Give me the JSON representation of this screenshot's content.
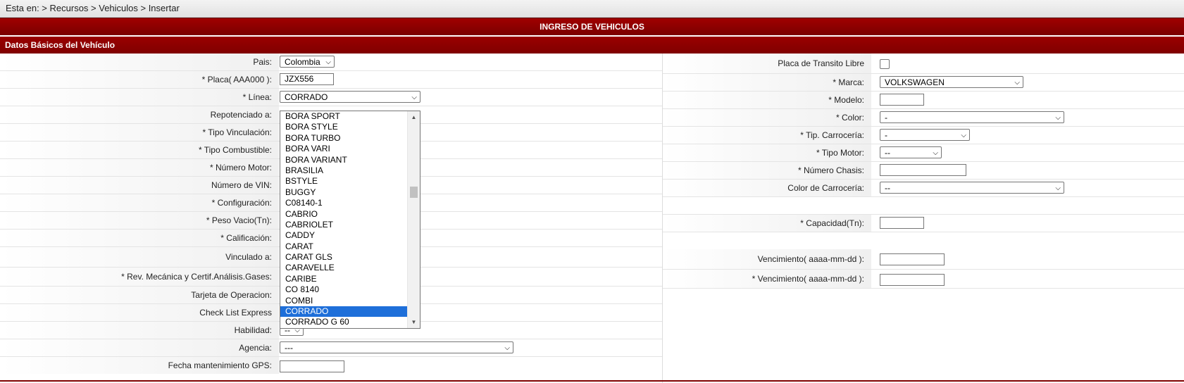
{
  "breadcrumb": "Esta en: > Recursos > Vehiculos > Insertar",
  "page_title": "INGRESO DE VEHICULOS",
  "section_title": "Datos Básicos del Vehículo",
  "left_rows": [
    {
      "label": "Pais:",
      "value": "Colombia"
    },
    {
      "label": "* Placa( AAA000 ):",
      "value": "JZX556"
    },
    {
      "label": "* Línea:",
      "value": "CORRADO"
    },
    {
      "label": "Repotenciado a:"
    },
    {
      "label": "* Tipo Vinculación:"
    },
    {
      "label": "* Tipo Combustible:"
    },
    {
      "label": "* Número Motor:"
    },
    {
      "label": "Número de VIN:"
    },
    {
      "label": "* Configuración:"
    },
    {
      "label": "* Peso Vacio(Tn):"
    },
    {
      "label": "* Calificación:"
    },
    {
      "label": "Vinculado a:"
    },
    {
      "label": "* Rev. Mecánica y Certif.Análisis.Gases:"
    },
    {
      "label": "Tarjeta de Operacion:"
    },
    {
      "label": "Check List Express"
    },
    {
      "label": "Habilidad:",
      "value": "--"
    },
    {
      "label": "Agencia:",
      "value": "---"
    },
    {
      "label": "Fecha mantenimiento GPS:",
      "value": ""
    }
  ],
  "right_rows": [
    {
      "label": "Placa de Transito Libre"
    },
    {
      "label": "* Marca:",
      "value": "VOLKSWAGEN"
    },
    {
      "label": "* Modelo:",
      "value": ""
    },
    {
      "label": "* Color:",
      "value": "-"
    },
    {
      "label": "* Tip. Carrocería:",
      "value": "-"
    },
    {
      "label": "* Tipo Motor:",
      "value": "--"
    },
    {
      "label": "* Número Chasis:",
      "value": ""
    },
    {
      "label": "Color de Carrocería:",
      "value": "--"
    },
    {
      "label": ""
    },
    {
      "label": "* Capacidad(Tn):",
      "value": ""
    },
    {
      "label": ""
    },
    {
      "label": "Vencimiento( aaaa-mm-dd ):",
      "value": ""
    },
    {
      "label": "* Vencimiento( aaaa-mm-dd ):",
      "value": ""
    }
  ],
  "linea_dropdown": {
    "options": [
      "BORA SPORT",
      "BORA STYLE",
      "BORA TURBO",
      "BORA VARI",
      "BORA VARIANT",
      "BRASILIA",
      "BSTYLE",
      "BUGGY",
      "C08140-1",
      "CABRIO",
      "CABRIOLET",
      "CADDY",
      "CARAT",
      "CARAT GLS",
      "CARAVELLE",
      "CARIBE",
      "CO 8140",
      "COMBI",
      "CORRADO",
      "CORRADO G 60"
    ],
    "selected": "CORRADO"
  },
  "icons": {
    "chevron": "chevron-down-icon",
    "scroll_up": "scroll-up-icon",
    "scroll_down": "scroll-down-icon"
  },
  "colors": {
    "header_red": "#8b0000",
    "selected_blue": "#1e6fd9"
  }
}
